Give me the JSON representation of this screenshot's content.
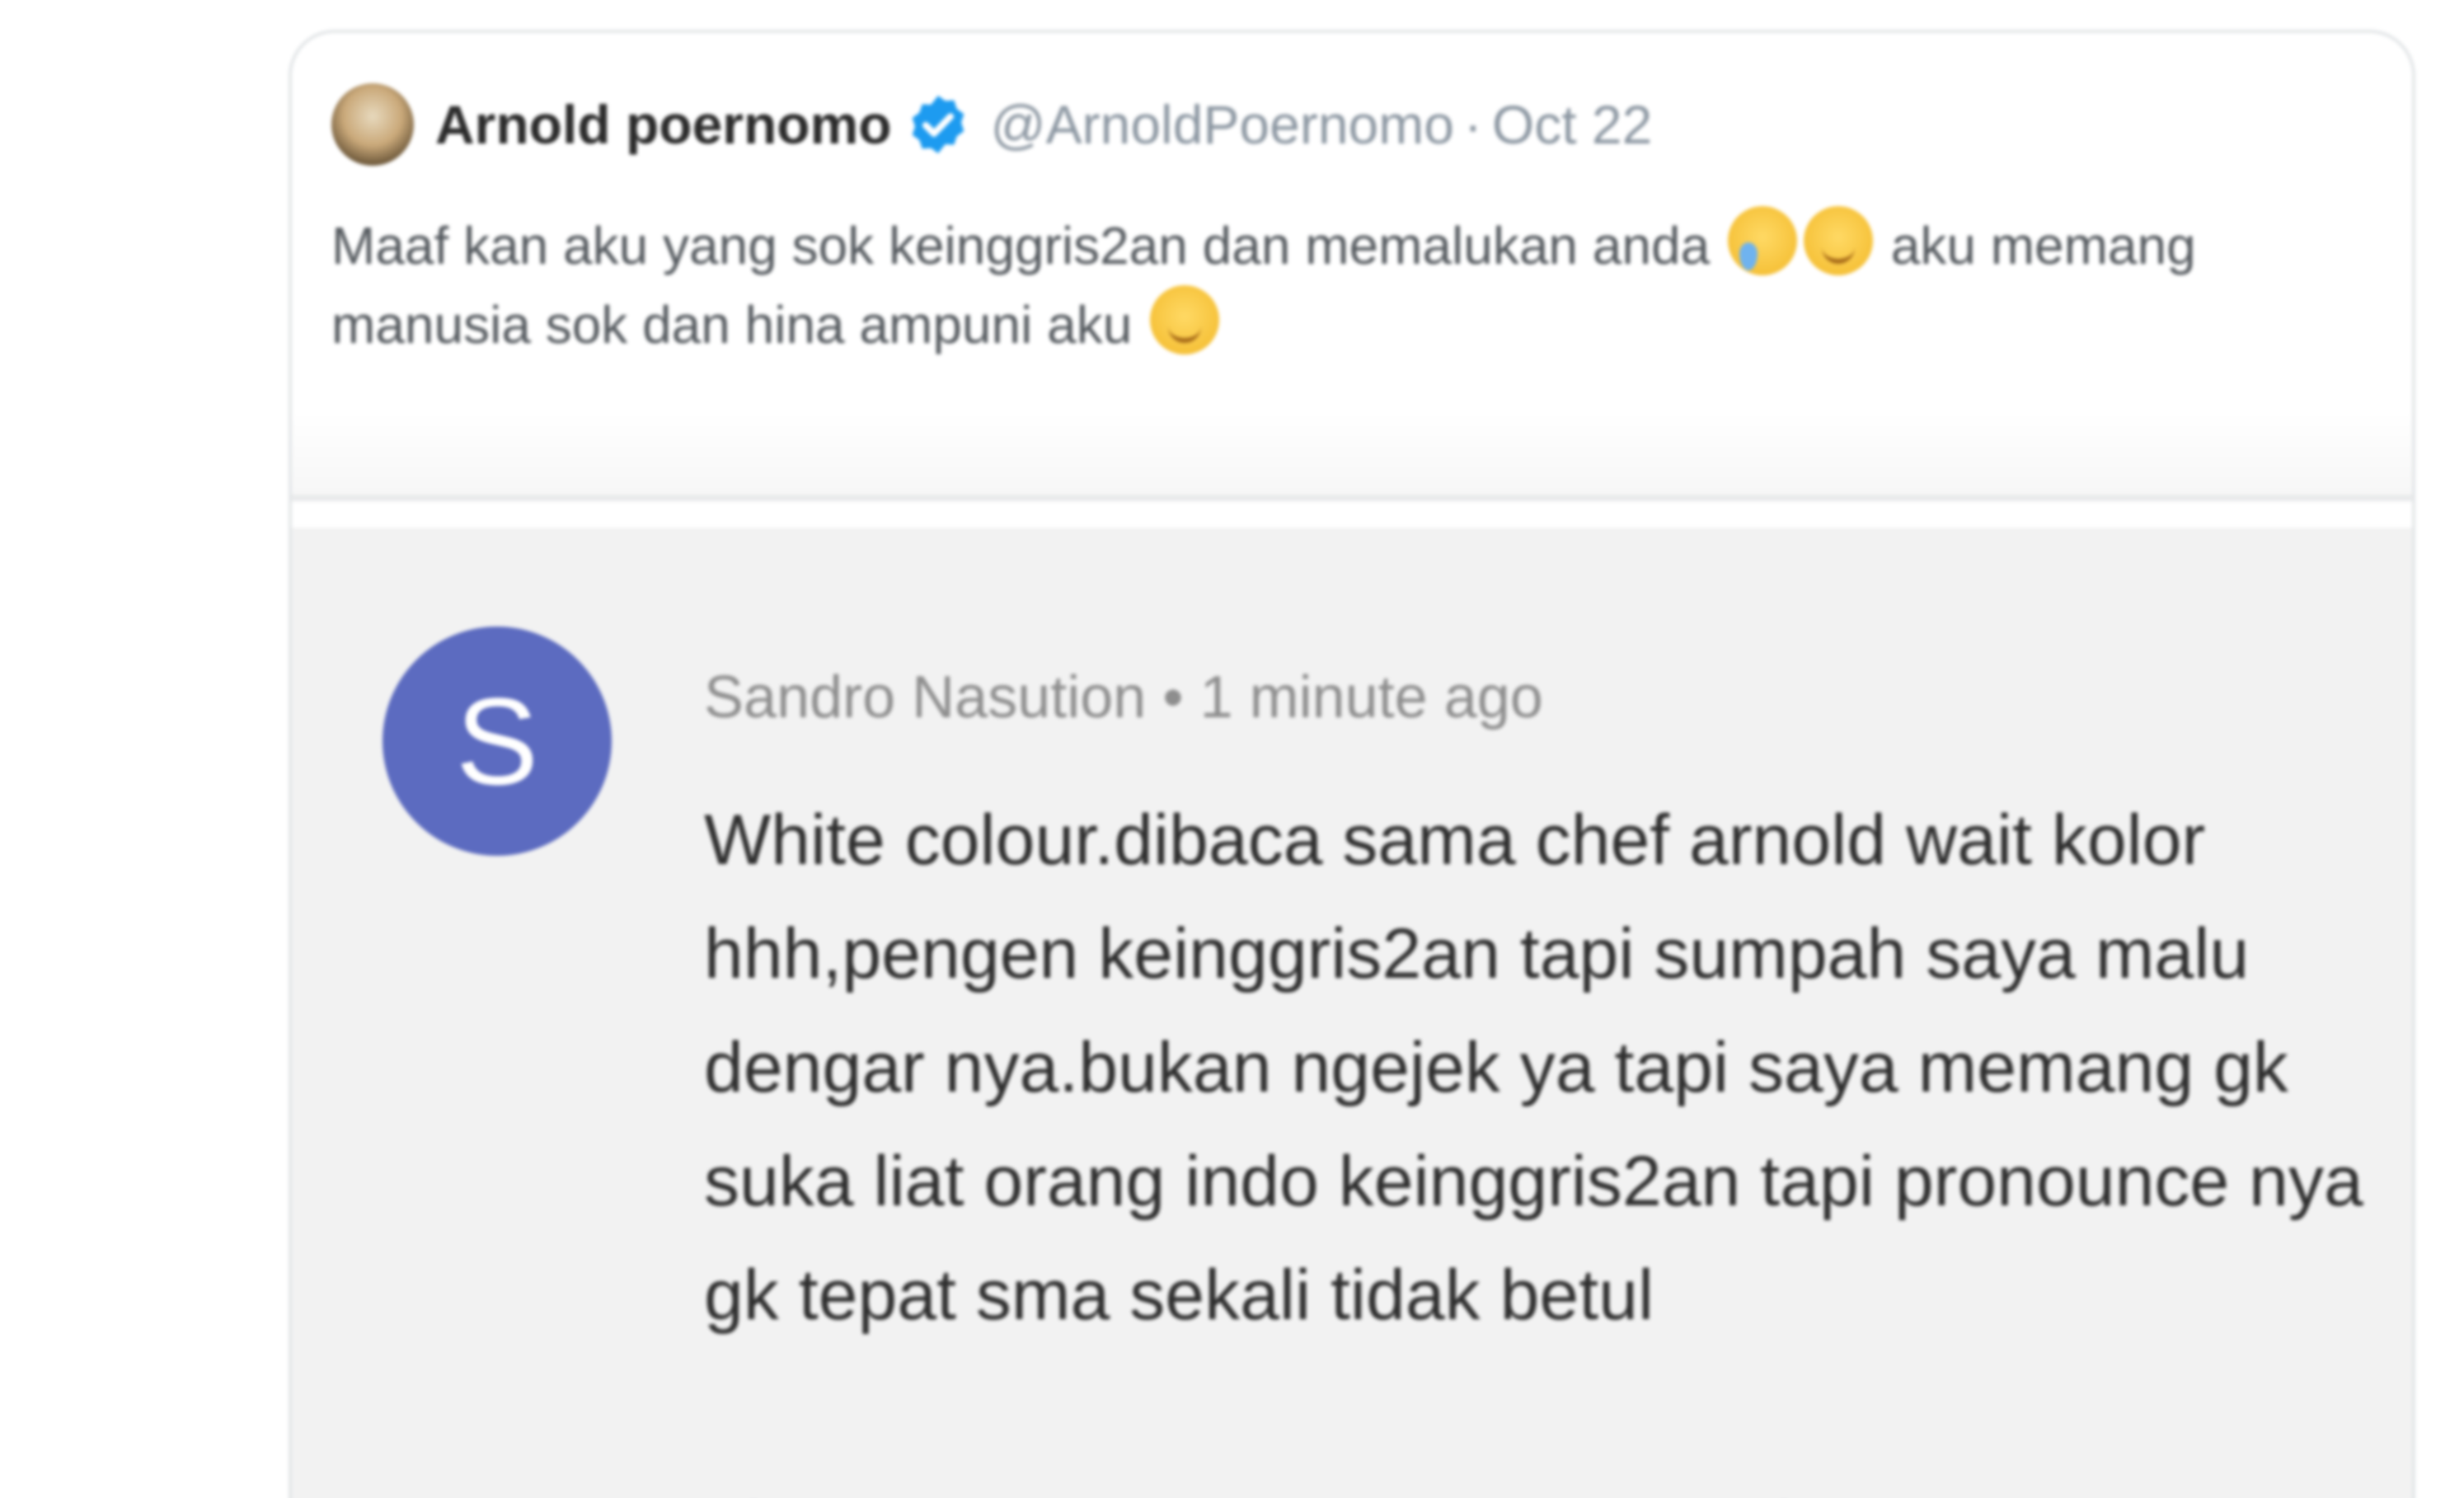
{
  "tweet": {
    "display_name": "Arnold poernomo",
    "handle": "@ArnoldPoernomo",
    "separator": "·",
    "date": "Oct 22",
    "text_part1": "Maaf kan aku yang sok keinggris2an dan memalukan anda",
    "text_part2": "aku memang manusia sok dan hina ampuni aku",
    "emojis": [
      "crying-face",
      "relieved-face",
      "relieved-face"
    ],
    "verified_color": "#1d9bf0"
  },
  "comment": {
    "avatar_letter": "S",
    "avatar_color": "#5c6bc0",
    "author": "Sandro Nasution",
    "bullet": "•",
    "time": "1 minute ago",
    "text": "White colour.dibaca sama chef arnold wait kolor hhh,pengen keinggris2an tapi sumpah saya malu dengar nya.bukan ngejek ya tapi saya memang gk suka liat orang indo keinggris2an tapi pronounce nya gk tepat sma sekali tidak betul"
  }
}
